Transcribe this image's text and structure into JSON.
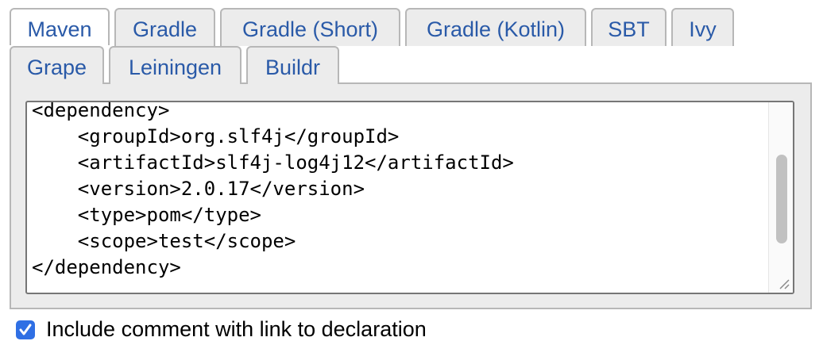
{
  "tabs": {
    "row1": [
      "Maven",
      "Gradle",
      "Gradle (Short)",
      "Gradle (Kotlin)",
      "SBT",
      "Ivy"
    ],
    "row2": [
      "Grape",
      "Leiningen",
      "Buildr"
    ],
    "active": "Maven"
  },
  "code": {
    "lines": [
      "<dependency>",
      "    <groupId>org.slf4j</groupId>",
      "    <artifactId>slf4j-log4j12</artifactId>",
      "    <version>2.0.17</version>",
      "    <type>pom</type>",
      "    <scope>test</scope>",
      "</dependency>"
    ]
  },
  "options": {
    "include_comment_checked": true,
    "include_comment_label": "Include comment with link to declaration"
  },
  "colors": {
    "tab_text": "#2a5aa8",
    "checkbox": "#2f6fe4"
  }
}
